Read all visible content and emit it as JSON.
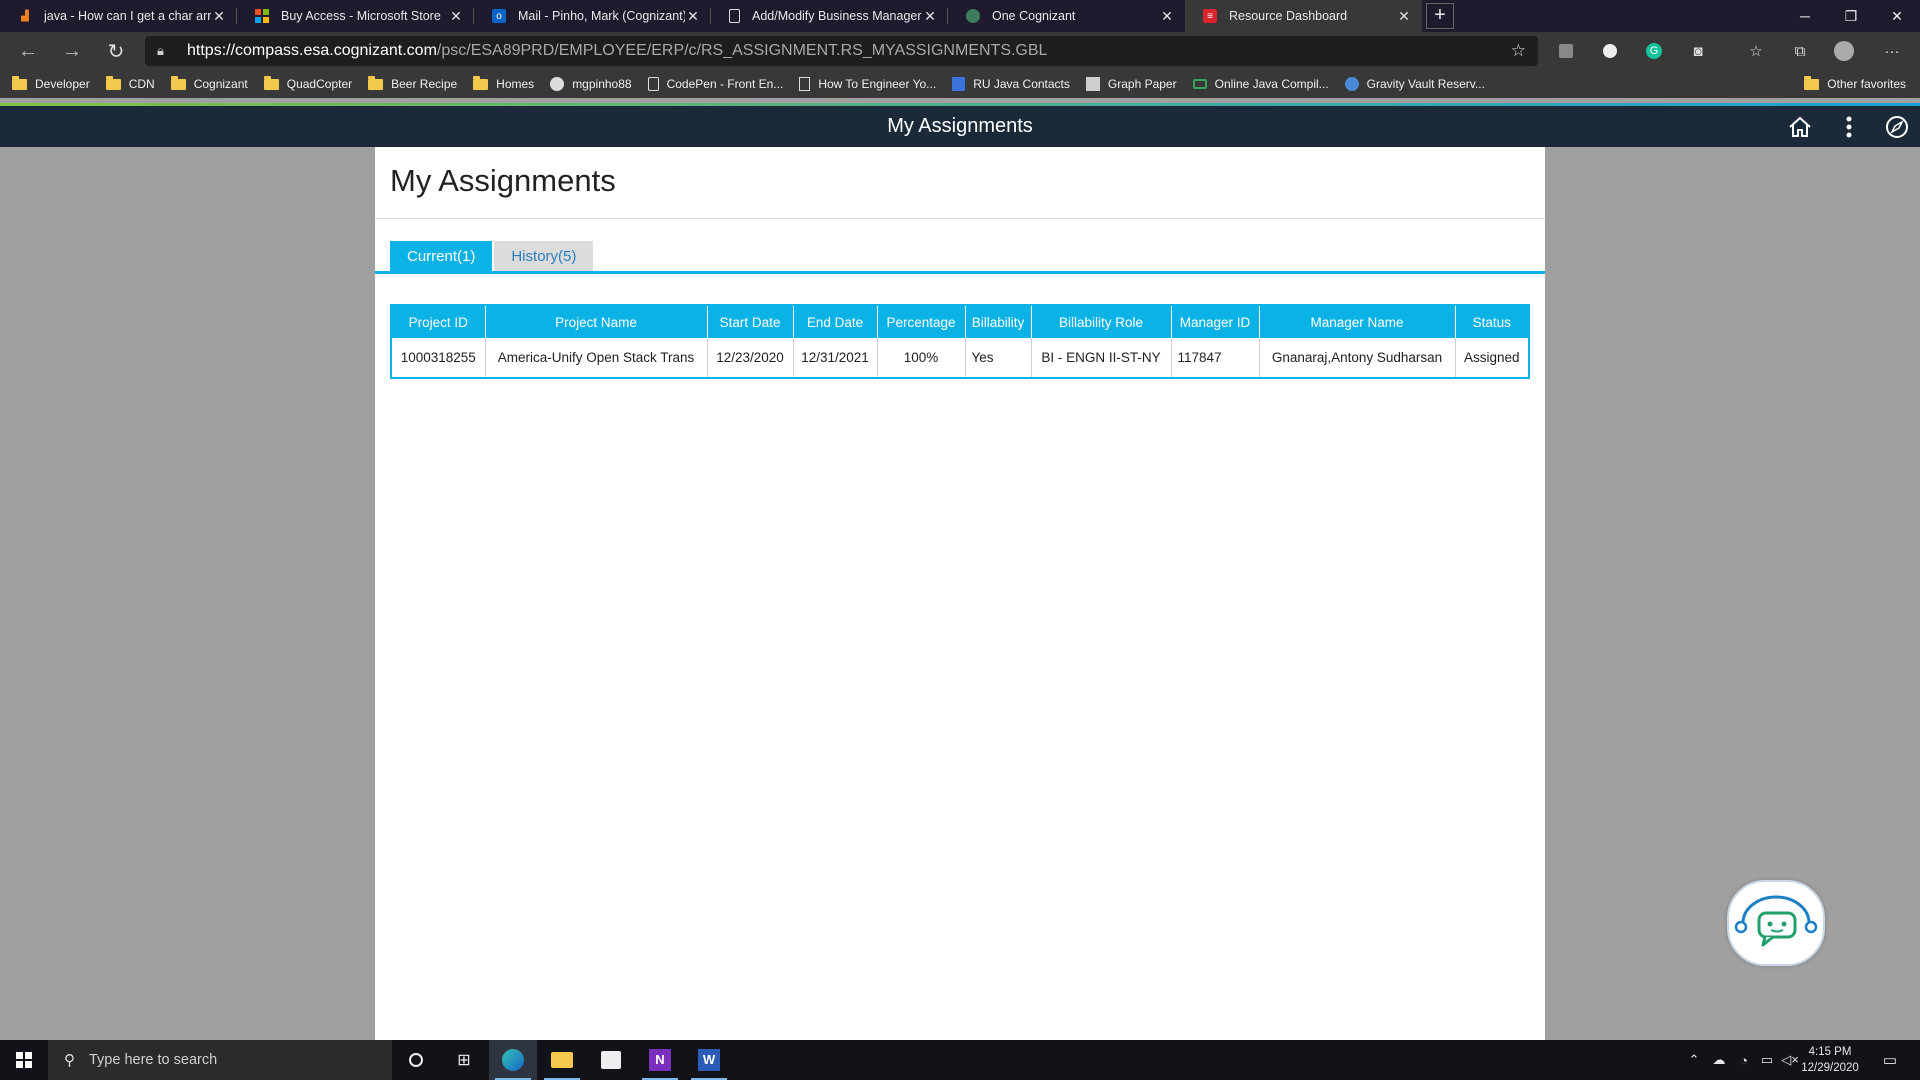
{
  "browser": {
    "tabs": [
      {
        "title": "java - How can I get a char array",
        "icon": "stackoverflow-icon",
        "active": false
      },
      {
        "title": "Buy Access - Microsoft Store",
        "icon": "microsoft-icon",
        "active": false
      },
      {
        "title": "Mail - Pinho, Mark (Cognizant) -",
        "icon": "outlook-icon",
        "active": false
      },
      {
        "title": "Add/Modify Business Manager",
        "icon": "page-icon",
        "active": false
      },
      {
        "title": "One Cognizant",
        "icon": "globe-icon",
        "active": false
      },
      {
        "title": "Resource Dashboard",
        "icon": "dashboard-icon",
        "active": true
      }
    ],
    "new_tab": "+",
    "url_host": "https://compass.esa.cognizant.com",
    "url_path": "/psc/ESA89PRD/EMPLOYEE/ERP/c/RS_ASSIGNMENT.RS_MYASSIGNMENTS.GBL",
    "favorites": [
      {
        "label": "Developer",
        "icon": "folder"
      },
      {
        "label": "CDN",
        "icon": "folder"
      },
      {
        "label": "Cognizant",
        "icon": "folder"
      },
      {
        "label": "QuadCopter",
        "icon": "folder"
      },
      {
        "label": "Beer Recipe",
        "icon": "folder"
      },
      {
        "label": "Homes",
        "icon": "folder"
      },
      {
        "label": "mgpinho88",
        "icon": "github"
      },
      {
        "label": "CodePen - Front En...",
        "icon": "codepen"
      },
      {
        "label": "How To Engineer Yo...",
        "icon": "page"
      },
      {
        "label": "RU Java Contacts",
        "icon": "doc"
      },
      {
        "label": "Graph Paper",
        "icon": "gray"
      },
      {
        "label": "Online Java Compil...",
        "icon": "green"
      },
      {
        "label": "Gravity Vault Reserv...",
        "icon": "gravity"
      }
    ],
    "other_favorites": "Other favorites"
  },
  "app": {
    "header_title": "My Assignments",
    "page_title": "My Assignments",
    "tabs": [
      {
        "label": "Current(1)",
        "active": true
      },
      {
        "label": "History(5)",
        "active": false
      }
    ],
    "table": {
      "columns": [
        "Project ID",
        "Project Name",
        "Start Date",
        "End Date",
        "Percentage",
        "Billability",
        "Billability Role",
        "Manager ID",
        "Manager Name",
        "Status"
      ],
      "rows": [
        [
          "1000318255",
          "America-Unify Open Stack Trans",
          "12/23/2020",
          "12/31/2021",
          "100%",
          "Yes",
          "BI - ENGN II-ST-NY",
          "117847",
          "Gnanaraj,Antony Sudharsan",
          "Assigned"
        ]
      ]
    }
  },
  "taskbar": {
    "search_placeholder": "Type here to search",
    "time": "4:15 PM",
    "date": "12/29/2020"
  },
  "colors": {
    "accent": "#0ab2e6",
    "header_bg": "#1b2a38"
  }
}
